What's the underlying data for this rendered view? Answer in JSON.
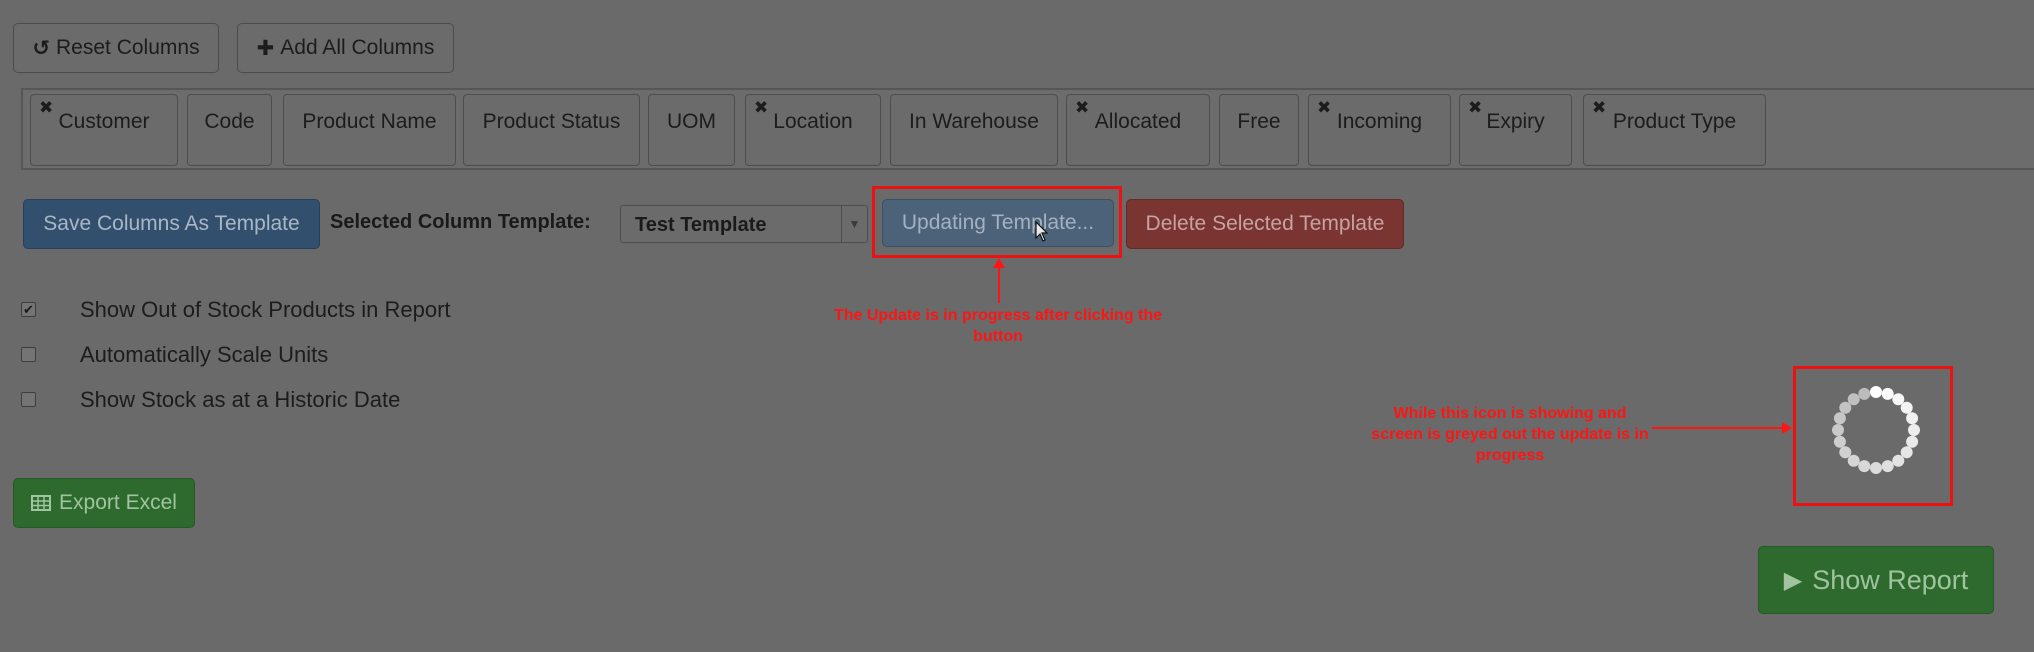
{
  "toolbar": {
    "reset_label": "Reset Columns",
    "reset_icon": "undo-icon",
    "add_all_label": "Add All Columns",
    "add_all_icon": "plus-icon"
  },
  "columns": [
    {
      "label": "Customer",
      "removable": true
    },
    {
      "label": "Code",
      "removable": false
    },
    {
      "label": "Product Name",
      "removable": false
    },
    {
      "label": "Product Status",
      "removable": false
    },
    {
      "label": "UOM",
      "removable": false
    },
    {
      "label": "Location",
      "removable": true
    },
    {
      "label": "In Warehouse",
      "removable": false
    },
    {
      "label": "Allocated",
      "removable": true
    },
    {
      "label": "Free",
      "removable": false
    },
    {
      "label": "Incoming",
      "removable": true
    },
    {
      "label": "Expiry",
      "removable": true
    },
    {
      "label": "Product Type",
      "removable": true
    }
  ],
  "template": {
    "save_label": "Save Columns As Template",
    "selected_label": "Selected Column Template:",
    "selected_value": "Test Template",
    "update_label": "Updating Template...",
    "delete_label": "Delete Selected Template"
  },
  "options": [
    {
      "label": "Show Out of Stock Products in Report",
      "checked": true
    },
    {
      "label": "Automatically Scale Units",
      "checked": false
    },
    {
      "label": "Show Stock as at a Historic Date",
      "checked": false
    }
  ],
  "actions": {
    "export_label": "Export Excel",
    "export_icon": "table-icon",
    "show_report_label": "Show Report",
    "show_report_icon": "play-icon"
  },
  "annotations": {
    "update_note": "The Update is in progress after clicking the button",
    "spinner_note": "While this icon is showing and screen is greyed out the update is in progress"
  },
  "colors": {
    "overlay_grey": "#6a6a6a",
    "annotation_red": "#ff1414",
    "primary": "#32506d",
    "danger": "#7a3532",
    "success": "#2e6a2e"
  }
}
